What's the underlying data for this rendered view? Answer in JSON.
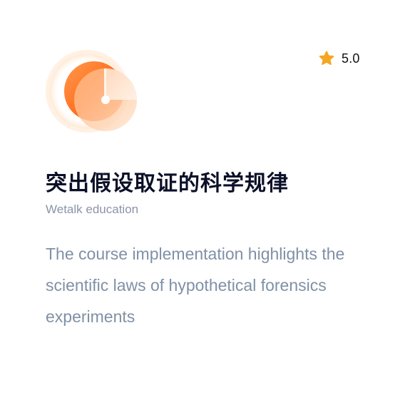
{
  "course": {
    "logo_icon": "orange-clock-pie-icon",
    "rating_icon": "star-icon",
    "rating_color": "#f5a623",
    "rating": "5.0",
    "title": "突出假设取证的科学规律",
    "provider": "Wetalk education",
    "description": "The course implementation highlights the scientific laws of hypothetical forensics experiments"
  },
  "colors": {
    "accent_orange": "#ff7a2e",
    "title": "#0b1028",
    "muted": "#8a94a8"
  }
}
